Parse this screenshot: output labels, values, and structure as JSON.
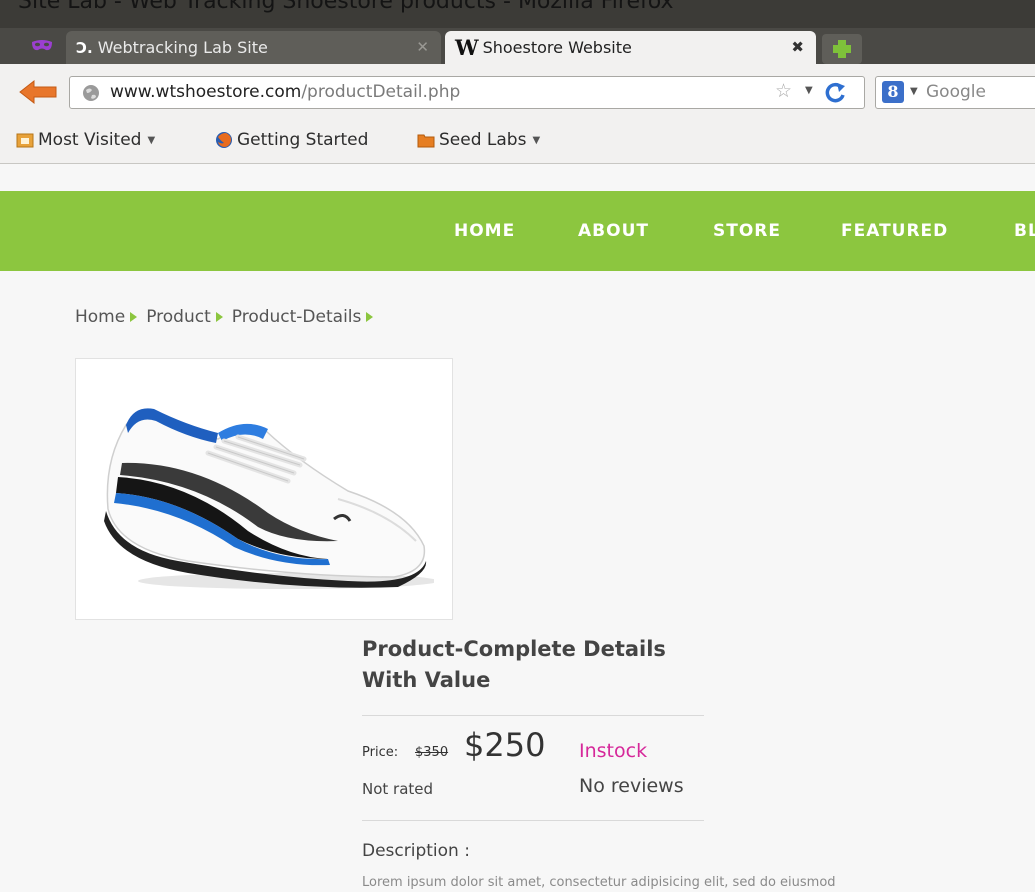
{
  "window": {
    "title": "Site Lab - Web Tracking Shoestore products - Mozilla Firefox"
  },
  "tabs": [
    {
      "label": "Webtracking Lab Site",
      "favicon": "e-icon",
      "active": false
    },
    {
      "label": "Shoestore Website",
      "favicon": "w-icon",
      "active": true
    }
  ],
  "navbar": {
    "url_host": "www.wtshoestore.com",
    "url_path": "/productDetail.php",
    "search_placeholder": "Google"
  },
  "bookmarks": [
    {
      "label": "Most Visited",
      "icon": "smart-folder-icon",
      "dropdown": true
    },
    {
      "label": "Getting Started",
      "icon": "firefox-icon",
      "dropdown": false
    },
    {
      "label": "Seed Labs",
      "icon": "folder-icon",
      "dropdown": true
    }
  ],
  "site_nav": [
    "HOME",
    "ABOUT",
    "STORE",
    "FEATURED",
    "BLOG"
  ],
  "breadcrumb": [
    "Home",
    "Product",
    "Product-Details"
  ],
  "product": {
    "title_line1": "Product-Complete Details",
    "title_line2": "With Value",
    "price_label": "Price:",
    "old_price": "$350",
    "new_price": "$250",
    "stock": "Instock",
    "rating": "Not rated",
    "reviews": "No reviews",
    "description_heading": "Description :",
    "description_text": "Lorem ipsum dolor sit amet, consectetur adipisicing elit, sed do eiusmod"
  },
  "colors": {
    "brand_green": "#8cc63f",
    "stock_pink": "#d6289a",
    "tab_bar": "#4a4945"
  }
}
